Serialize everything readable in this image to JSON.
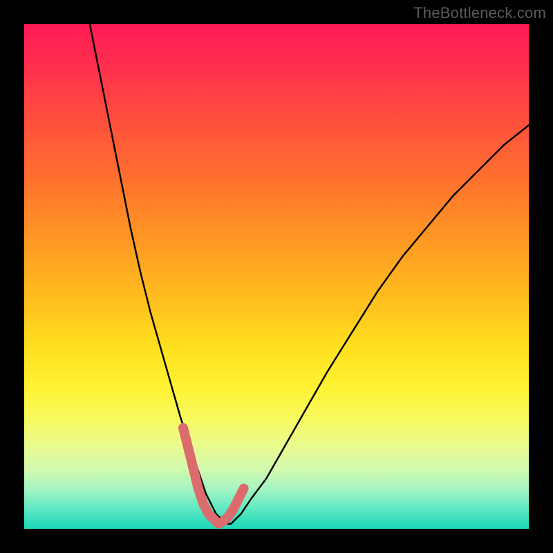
{
  "watermark": "TheBottleneck.com",
  "chart_data": {
    "type": "line",
    "title": "",
    "xlabel": "",
    "ylabel": "",
    "xlim": [
      0,
      100
    ],
    "ylim": [
      0,
      100
    ],
    "grid": false,
    "series": [
      {
        "name": "black-curve",
        "color": "#000000",
        "x": [
          13,
          15,
          17,
          19,
          21,
          23,
          25,
          27,
          29,
          31,
          33,
          34,
          35,
          36,
          37,
          38,
          39,
          40,
          41,
          42,
          43,
          45,
          48,
          52,
          56,
          60,
          65,
          70,
          75,
          80,
          85,
          90,
          95,
          100
        ],
        "values": [
          100,
          90,
          80,
          70,
          60,
          51,
          43,
          36,
          29,
          22,
          16,
          13,
          10,
          7,
          5,
          3,
          2,
          1,
          1,
          2,
          3,
          6,
          10,
          17,
          24,
          31,
          39,
          47,
          54,
          60,
          66,
          71,
          76,
          80
        ]
      },
      {
        "name": "highlight-band",
        "color": "#db6b6d",
        "x": [
          31.5,
          32.5,
          33.5,
          34.5,
          35.5,
          36.5,
          37.5,
          38.5,
          39.5,
          40.5,
          41.5,
          42.5,
          43.5
        ],
        "values": [
          20,
          16,
          12,
          8,
          5,
          3,
          2,
          1,
          1.5,
          2.5,
          4,
          6,
          8
        ]
      }
    ],
    "note": "Values are percentage estimates read from the figure; the chart has no axis ticks or numeric labels so values are approximate positions within a 0-100 range on both axes."
  }
}
